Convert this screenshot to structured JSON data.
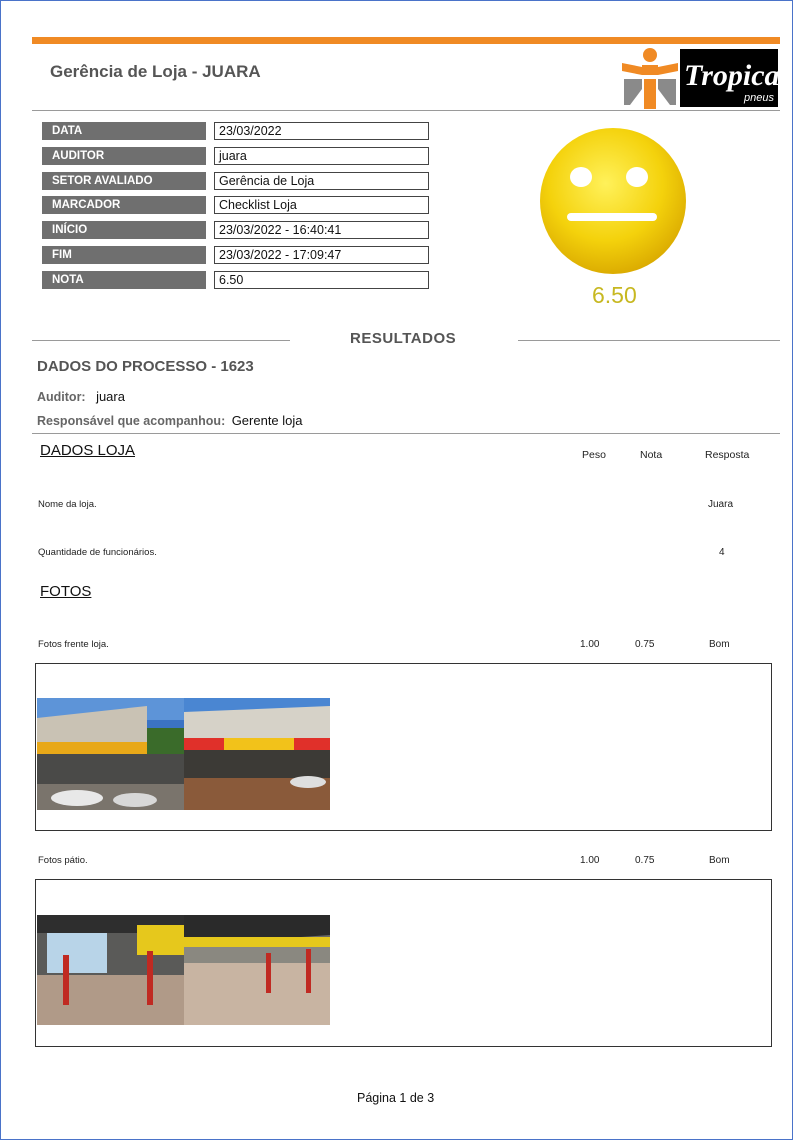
{
  "header": {
    "title": "Gerência de Loja - JUARA",
    "logo_text": "Tropical",
    "logo_sub": "pneus"
  },
  "fields": [
    {
      "label": "DATA",
      "value": "23/03/2022"
    },
    {
      "label": "AUDITOR",
      "value": "juara"
    },
    {
      "label": "SETOR AVALIADO",
      "value": "Gerência de Loja"
    },
    {
      "label": "MARCADOR",
      "value": "Checklist Loja"
    },
    {
      "label": "INÍCIO",
      "value": "23/03/2022 - 16:40:41"
    },
    {
      "label": "FIM",
      "value": "23/03/2022 - 17:09:47"
    },
    {
      "label": "NOTA",
      "value": "6.50"
    }
  ],
  "score": {
    "value": "6.50",
    "face": "neutral-face-icon",
    "color": "#c7b821"
  },
  "results": {
    "title": "RESULTADOS",
    "process_title": "DADOS DO PROCESSO - 1623",
    "auditor_label": "Auditor:",
    "auditor_value": "juara",
    "responsavel_label": "Responsável que acompanhou:",
    "responsavel_value": "Gerente loja"
  },
  "sections": {
    "loja": {
      "title": "DADOS LOJA",
      "col_peso": "Peso",
      "col_nota": "Nota",
      "col_resposta": "Resposta",
      "items": [
        {
          "question": "Nome da loja.",
          "peso": "",
          "nota": "",
          "resposta": "Juara"
        },
        {
          "question": "Quantidade de funcionários.",
          "peso": "",
          "nota": "",
          "resposta": "4"
        }
      ]
    },
    "fotos": {
      "title": "FOTOS",
      "items": [
        {
          "question": "Fotos frente loja.",
          "peso": "1.00",
          "nota": "0.75",
          "resposta": "Bom"
        },
        {
          "question": "Fotos pátio.",
          "peso": "1.00",
          "nota": "0.75",
          "resposta": "Bom"
        }
      ]
    }
  },
  "footer": {
    "page": "Página 1 de 3"
  }
}
